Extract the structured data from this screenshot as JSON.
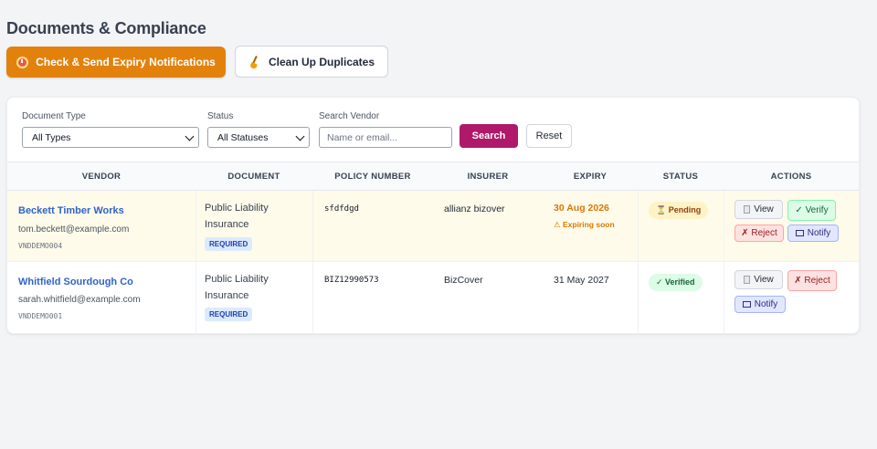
{
  "page": {
    "title": "Documents & Compliance"
  },
  "toolbar": {
    "primary_label": "Check & Send Expiry Notifications",
    "primary_icon": "alarm-clock-icon",
    "secondary_label": "Clean Up Duplicates",
    "secondary_icon": "broom-icon"
  },
  "filters": {
    "doc_type_label": "Document Type",
    "doc_type_value": "All Types",
    "status_label": "Status",
    "status_value": "All Statuses",
    "search_label": "Search Vendor",
    "search_placeholder": "Name or email...",
    "search_button": "Search",
    "reset_button": "Reset"
  },
  "table": {
    "headers": [
      "VENDOR",
      "DOCUMENT",
      "POLICY NUMBER",
      "INSURER",
      "EXPIRY",
      "STATUS",
      "ACTIONS"
    ],
    "rows": [
      {
        "vendor_name": "Beckett Timber Works",
        "vendor_email": "tom.beckett@example.com",
        "vendor_id": "VNDDEMO004",
        "document": "Public Liability Insurance",
        "required": "REQUIRED",
        "policy": "sfdfdgd",
        "insurer": "allianz bizover",
        "expiry": "30 Aug 2026",
        "expiry_note": "⚠ Expiring soon",
        "status": "⏳ Pending",
        "actions": {
          "view": "View",
          "verify": "✓ Verify",
          "reject": "✗ Reject",
          "notify": "Notify"
        }
      },
      {
        "vendor_name": "Whitfield Sourdough Co",
        "vendor_email": "sarah.whitfield@example.com",
        "vendor_id": "VNDDEMO001",
        "document": "Public Liability Insurance",
        "required": "REQUIRED",
        "policy": "BIZ12990573",
        "insurer": "BizCover",
        "expiry": "31 May 2027",
        "status": "✓ Verified",
        "actions": {
          "view": "View",
          "reject": "✗ Reject",
          "notify": "Notify"
        }
      }
    ]
  },
  "colors": {
    "primary_button": "#e2820c",
    "search_button": "#b0186a",
    "link": "#2f63c9",
    "warning": "#d97706",
    "pending_row": "#fffbea"
  }
}
